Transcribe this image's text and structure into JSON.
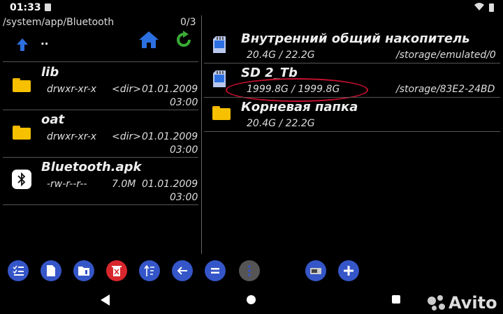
{
  "status_bar": {
    "time": "01:33"
  },
  "left_panel": {
    "path": "/system/app/Bluetooth",
    "count": "0/3",
    "parent_label": "..",
    "items": [
      {
        "name": "lib",
        "perms": "drwxr-xr-x",
        "size": "<dir>",
        "date": "01.01.2009",
        "time": "03:00",
        "icon": "folder-icon"
      },
      {
        "name": "oat",
        "perms": "drwxr-xr-x",
        "size": "<dir>",
        "date": "01.01.2009",
        "time": "03:00",
        "icon": "folder-icon"
      },
      {
        "name": "Bluetooth.apk",
        "perms": "-rw-r--r--",
        "size": "7.0M",
        "date": "01.01.2009",
        "time": "03:00",
        "icon": "bluetooth-app-icon"
      }
    ]
  },
  "right_panel": {
    "storages": [
      {
        "name": "Внутренний общий накопитель",
        "usage": "20.4G / 22.2G",
        "path": "/storage/emulated/0",
        "icon": "sd-card-icon"
      },
      {
        "name": "SD 2_Tb",
        "usage": "1999.8G / 1999.8G",
        "path": "/storage/83E2-24BD",
        "icon": "sd-card-icon"
      },
      {
        "name": "Корневая папка",
        "usage": "20.4G / 22.2G",
        "path": "",
        "icon": "folder-icon"
      }
    ]
  },
  "toolbar": {
    "buttons": [
      "select-icon",
      "new-file-icon",
      "new-folder-icon",
      "delete-icon",
      "sort-icon",
      "back-arrow-icon",
      "equal-icon",
      "more-icon",
      "drive-icon",
      "add-icon"
    ]
  },
  "watermark": {
    "text": "Avito"
  },
  "colors": {
    "accent": "#3556c8",
    "folder": "#f7c000",
    "delete": "#d8272c",
    "highlight": "#c8102e",
    "refresh": "#3aaa35"
  }
}
